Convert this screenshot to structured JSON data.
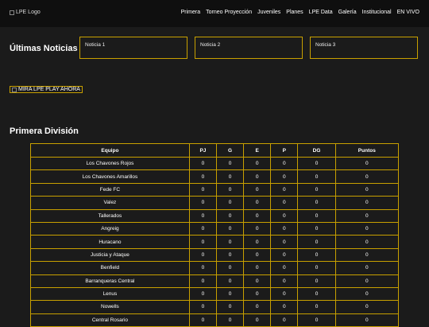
{
  "header": {
    "logo_alt": "LPE Logo",
    "nav": [
      "Primera",
      "Torneo Proyección",
      "Juveniles",
      "Planes",
      "LPE Data",
      "Galería",
      "Institucional",
      "EN VIVO"
    ]
  },
  "news": {
    "title": "Últimas Noticias",
    "cards": [
      "Noticia 1",
      "Noticia 2",
      "Noticia 3"
    ]
  },
  "promo": {
    "label": "MIRA LPE PLAY AHORA"
  },
  "standings": {
    "title": "Primera División",
    "headers": [
      "Equipo",
      "PJ",
      "G",
      "E",
      "P",
      "DG",
      "Puntos"
    ],
    "rows": [
      [
        "Los Chavones Rojos",
        "0",
        "0",
        "0",
        "0",
        "0",
        "0"
      ],
      [
        "Los Chavones Amarillos",
        "0",
        "0",
        "0",
        "0",
        "0",
        "0"
      ],
      [
        "Fede FC",
        "0",
        "0",
        "0",
        "0",
        "0",
        "0"
      ],
      [
        "Valez",
        "0",
        "0",
        "0",
        "0",
        "0",
        "0"
      ],
      [
        "Tallerados",
        "0",
        "0",
        "0",
        "0",
        "0",
        "0"
      ],
      [
        "Angreig",
        "0",
        "0",
        "0",
        "0",
        "0",
        "0"
      ],
      [
        "Huracano",
        "0",
        "0",
        "0",
        "0",
        "0",
        "0"
      ],
      [
        "Justicia y Ataque",
        "0",
        "0",
        "0",
        "0",
        "0",
        "0"
      ],
      [
        "Benfield",
        "0",
        "0",
        "0",
        "0",
        "0",
        "0"
      ],
      [
        "Barranqueras Central",
        "0",
        "0",
        "0",
        "0",
        "0",
        "0"
      ],
      [
        "Lenus",
        "0",
        "0",
        "0",
        "0",
        "0",
        "0"
      ],
      [
        "Nowells",
        "0",
        "0",
        "0",
        "0",
        "0",
        "0"
      ],
      [
        "Central Rosario",
        "0",
        "0",
        "0",
        "0",
        "0",
        "0"
      ]
    ]
  }
}
